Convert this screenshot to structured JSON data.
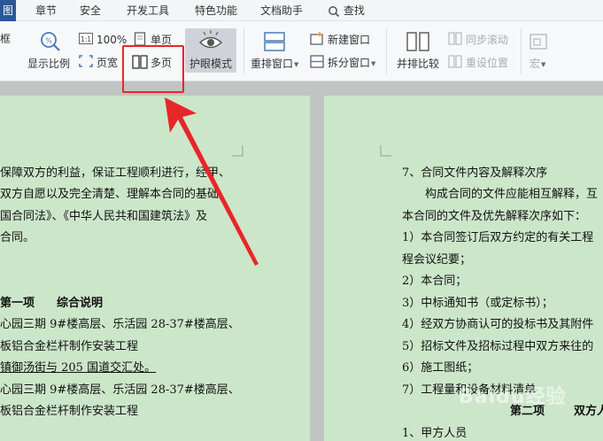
{
  "menu": {
    "tabs": [
      "图",
      "章节",
      "安全",
      "开发工具",
      "特色功能",
      "文档助手"
    ],
    "search_label": "查找"
  },
  "ribbon": {
    "frame_label": "框",
    "display_ratio": "显示比例",
    "zoom_100": "100%",
    "page_width": "页宽",
    "single_page": "单页",
    "multi_page": "多页",
    "eye_mode": "护眼模式",
    "rearrange_window": "重排窗口",
    "new_window": "新建窗口",
    "split_window": "拆分窗口",
    "side_by_side": "并排比较",
    "sync_scroll": "同步滚动",
    "reset_position": "重设位置",
    "macro": "宏"
  },
  "document": {
    "left_page": [
      "保障双方的利益，保证工程顺利进行，经甲、",
      "双方自愿以及完全清楚、理解本合同的基础",
      "国合同法》、《中华人民共和国建筑法》及",
      "合同。",
      "第一项",
      "综合说明",
      "心园三期 9#楼高层、乐活园 28-37#楼高层、",
      "板铝合金栏杆制作安装工程",
      "镇御汤街与 205 国道交汇处。",
      "心园三期 9#楼高层、乐活园 28-37#楼高层、",
      "板铝合金栏杆制作安装工程"
    ],
    "right_page": [
      "7、合同文件内容及解释次序",
      "构成合同的文件应能相互解释，互",
      "本合同的文件及优先解释次序如下：",
      "1）本合同签订后双方约定的有关工程",
      "程会议纪要；",
      "2）本合同；",
      "3）中标通知书（或定标书）；",
      "4）经双方协商认可的投标书及其附件",
      "5）招标文件及招标过程中双方来往的",
      "6）施工图纸；",
      "7）工程量和设备材料清单",
      "第二项",
      "双方人",
      "1、甲方人员"
    ]
  },
  "watermark": "Baidu经验",
  "colors": {
    "active_tab": "#2b5797",
    "eye_green": "#cce6c9",
    "highlight_red": "#e8262a"
  }
}
